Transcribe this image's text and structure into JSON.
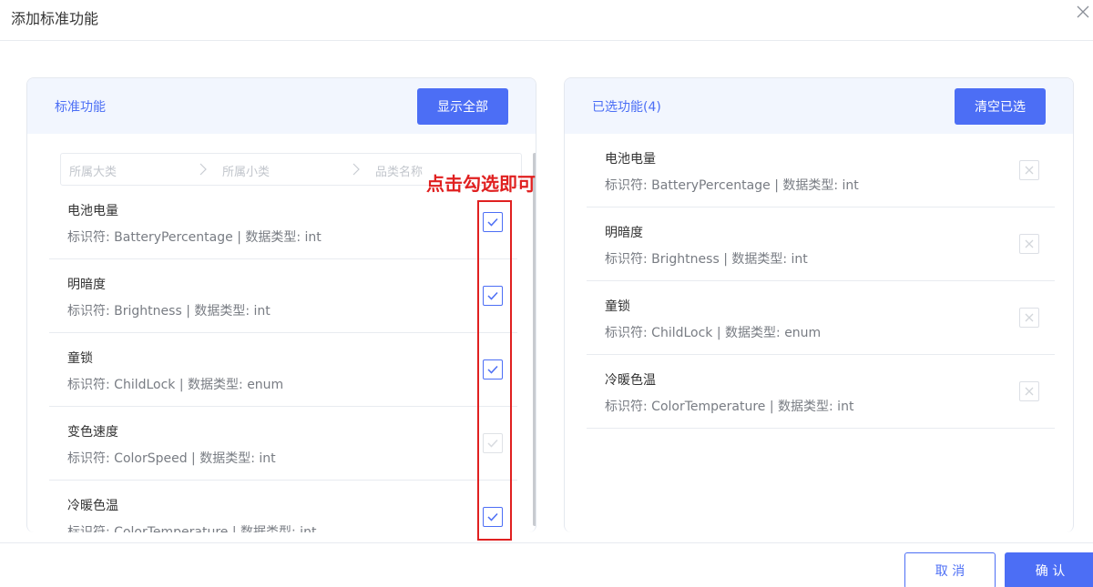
{
  "dialog": {
    "title": "添加标准功能",
    "close_icon": "close-icon"
  },
  "left_panel": {
    "title": "标准功能",
    "show_all_label": "显示全部",
    "filter": {
      "major": "所属大类",
      "minor": "所属小类",
      "name": "品类名称"
    },
    "items": [
      {
        "name": "电池电量",
        "desc": "标识符: BatteryPercentage | 数据类型: int",
        "checked": true,
        "disabled": false
      },
      {
        "name": "明暗度",
        "desc": "标识符: Brightness | 数据类型: int",
        "checked": true,
        "disabled": false
      },
      {
        "name": "童锁",
        "desc": "标识符: ChildLock | 数据类型: enum",
        "checked": true,
        "disabled": false
      },
      {
        "name": "变色速度",
        "desc": "标识符: ColorSpeed | 数据类型: int",
        "checked": true,
        "disabled": true
      },
      {
        "name": "冷暖色温",
        "desc": "标识符: ColorTemperature | 数据类型: int",
        "checked": true,
        "disabled": false
      }
    ]
  },
  "annotation": {
    "text": "点击勾选即可",
    "color": "#e02020"
  },
  "right_panel": {
    "title": "已选功能(4)",
    "clear_label": "清空已选",
    "items": [
      {
        "name": "电池电量",
        "desc": "标识符: BatteryPercentage | 数据类型: int"
      },
      {
        "name": "明暗度",
        "desc": "标识符: Brightness | 数据类型: int"
      },
      {
        "name": "童锁",
        "desc": "标识符: ChildLock | 数据类型: enum"
      },
      {
        "name": "冷暖色温",
        "desc": "标识符: ColorTemperature | 数据类型: int"
      }
    ]
  },
  "footer": {
    "cancel_label": "取 消",
    "ok_label": "确 认"
  },
  "colors": {
    "accent": "#4c6ef5",
    "panel_header_bg": "#f2f6fe",
    "annotation": "#e02020"
  }
}
